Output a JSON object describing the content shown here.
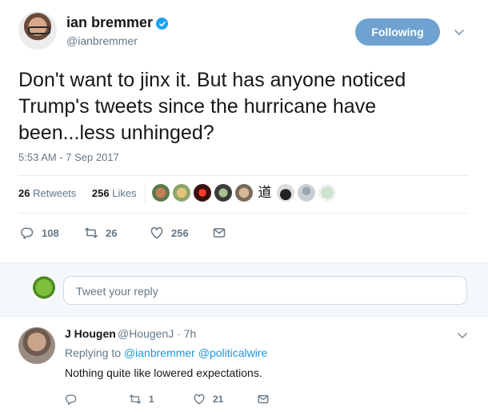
{
  "tweet": {
    "author_name": "ian bremmer",
    "author_handle": "@ianbremmer",
    "follow_label": "Following",
    "text": "Don't want to jinx it. But has anyone noticed Trump's tweets since the hurricane have been...less unhinged?",
    "timestamp": "5:53 AM - 7 Sep 2017",
    "retweets_count": "26",
    "retweets_label": "Retweets",
    "likes_count": "256",
    "likes_label": "Likes",
    "actions": {
      "reply_count": "108",
      "retweet_count": "26",
      "like_count": "256"
    }
  },
  "reply_box": {
    "placeholder": "Tweet your reply"
  },
  "reply": {
    "name": "J Hougen",
    "handle": "@HougenJ · 7h",
    "replying_prefix": "Replying to",
    "replying_to_1": "@ianbremmer",
    "replying_to_2": "@politicalwire",
    "text": "Nothing quite like lowered expectations.",
    "actions": {
      "reply_count": "",
      "retweet_count": "1",
      "like_count": "21"
    }
  },
  "colors": {
    "accent": "#1da1f2",
    "follow_button": "#6fa2d1",
    "muted_text": "#657786",
    "link": "#1b95e0"
  },
  "icons": [
    "verified-badge-icon",
    "chevron-down-icon",
    "reply-icon",
    "retweet-icon",
    "like-icon",
    "direct-message-icon"
  ]
}
